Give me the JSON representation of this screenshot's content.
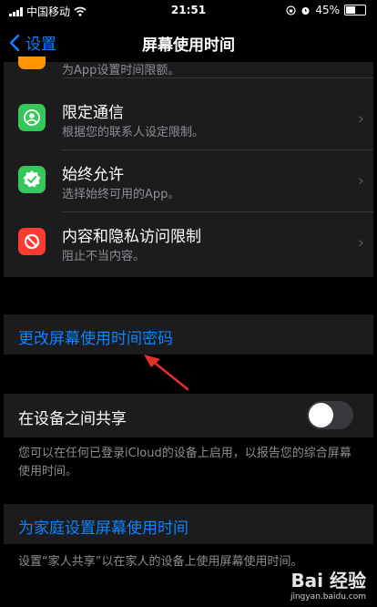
{
  "status_bar": {
    "carrier": "中国移动",
    "time": "21:51",
    "battery": "45%"
  },
  "nav": {
    "back_label": "设置",
    "title": "屏幕使用时间"
  },
  "list": {
    "partial_row_subtitle": "为App设置时间限额。",
    "items": [
      {
        "title": "限定通信",
        "subtitle": "根据您的联系人设定限制。",
        "icon": "communication-limits-icon",
        "color": "#34c759"
      },
      {
        "title": "始终允许",
        "subtitle": "选择始终可用的App。",
        "icon": "always-allowed-icon",
        "color": "#34c759"
      },
      {
        "title": "内容和隐私访问限制",
        "subtitle": "阻止不当内容。",
        "icon": "content-privacy-restrictions-icon",
        "color": "#ff3b30"
      }
    ]
  },
  "change_passcode_label": "更改屏幕使用时间密码",
  "share_across_devices": {
    "label": "在设备之间共享",
    "enabled": false
  },
  "share_footnote": "您可以在任何已登录iCloud的设备上启用，以报告您的综合屏幕使用时间。",
  "family_setup_label": "为家庭设置屏幕使用时间",
  "family_footnote": "设置“家人共享”以在家人的设备上使用屏幕使用时间。",
  "watermark": {
    "brand": "Bai 经验",
    "url": "jingyan.baidu.com"
  }
}
